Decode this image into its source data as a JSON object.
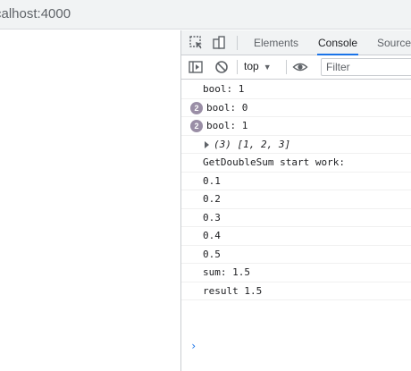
{
  "browser": {
    "url_visible": "calhost:4000"
  },
  "devtools": {
    "tabs": [
      {
        "label": "Elements",
        "active": false
      },
      {
        "label": "Console",
        "active": true
      },
      {
        "label": "Sources",
        "active": false
      }
    ],
    "toolbar": {
      "context": "top",
      "filter_placeholder": "Filter"
    },
    "console": {
      "messages": [
        {
          "text": "bool: 1"
        },
        {
          "text": "bool: 0",
          "count": "2"
        },
        {
          "text": "bool: 1",
          "count": "2"
        },
        {
          "text": "(3) [1, 2, 3]",
          "expandable": true
        },
        {
          "text": "GetDoubleSum start work:"
        },
        {
          "text": "0.1"
        },
        {
          "text": "0.2"
        },
        {
          "text": "0.3"
        },
        {
          "text": "0.4"
        },
        {
          "text": "0.5"
        },
        {
          "text": "sum: 1.5"
        },
        {
          "text": "result 1.5"
        }
      ],
      "prompt_symbol": "›"
    }
  },
  "colors": {
    "accent": "#1a73e8",
    "badge": "#9a8ea6",
    "chrome_bg": "#f1f3f4"
  }
}
